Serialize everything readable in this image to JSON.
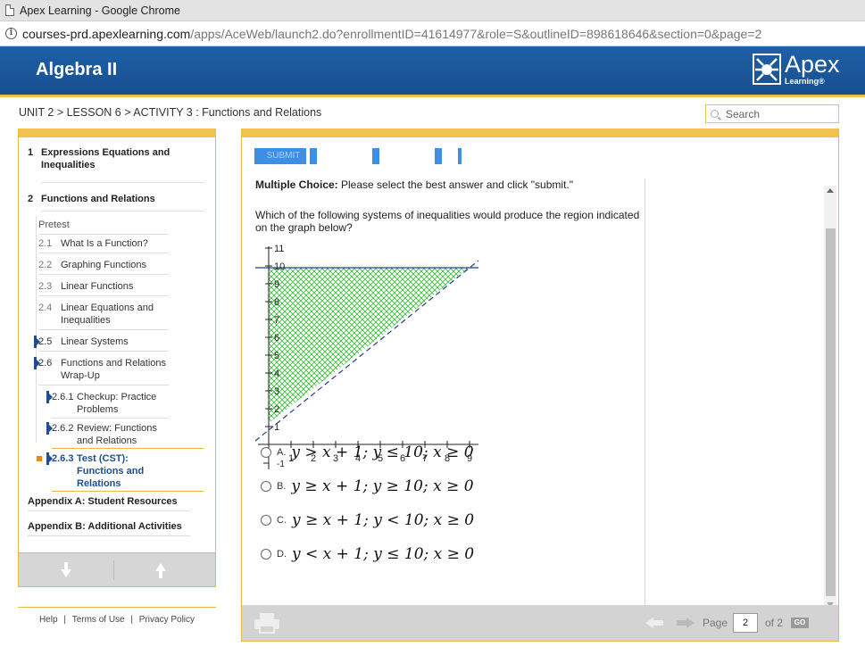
{
  "window": {
    "title": "Apex Learning - Google Chrome",
    "url_host": "courses-prd.apexlearning.com",
    "url_path": "/apps/AceWeb/launch2.do?enrollmentID=41614977&role=S&outlineID=898618646&section=0&page=2"
  },
  "header": {
    "course_title": "Algebra II",
    "logo_name": "Apex",
    "logo_sub": "Learning®"
  },
  "breadcrumb": "UNIT 2 > LESSON 6 > ACTIVITY 3 : Functions and Relations",
  "search": {
    "placeholder": "Search"
  },
  "nav": {
    "items": [
      {
        "num": "1",
        "label": "Expressions Equations and",
        "label2": "Inequalities"
      },
      {
        "num": "2",
        "label": "Functions and Relations"
      },
      {
        "num": "",
        "label": "Pretest"
      },
      {
        "num": "2.1",
        "label": "What Is a Function?"
      },
      {
        "num": "2.2",
        "label": "Graphing Functions"
      },
      {
        "num": "2.3",
        "label": "Linear Functions"
      },
      {
        "num": "2.4",
        "label": "Linear Equations and",
        "label2": "Inequalities"
      },
      {
        "num": "2.5",
        "label": "Linear Systems"
      },
      {
        "num": "2.6",
        "label": "Functions and Relations",
        "label2": "Wrap-Up"
      },
      {
        "num": "2.6.1",
        "label": "Checkup: Practice",
        "label2": "Problems"
      },
      {
        "num": "2.6.2",
        "label": "Review: Functions",
        "label2": "and Relations"
      },
      {
        "num": "2.6.3",
        "label": "Test (CST):",
        "label2": "Functions and",
        "label3": "Relations"
      },
      {
        "num": "",
        "label": "Appendix A: Student Resources"
      },
      {
        "num": "",
        "label": "Appendix B: Additional Activities"
      }
    ]
  },
  "footer_links": {
    "help": "Help",
    "terms": "Terms of Use",
    "privacy": "Privacy Policy",
    "sep": "|"
  },
  "question": {
    "submit_label": "SUBMIT",
    "type_label": "Multiple Choice:",
    "instructions": "Please select the best answer and click \"submit.\"",
    "prompt": "Which of the following systems of inequalities would produce the region indicated on the graph below?",
    "graph": {
      "x_ticks": [
        "1",
        "2",
        "3",
        "4",
        "5",
        "6",
        "7",
        "8",
        "9"
      ],
      "x_neg_label": "-1",
      "y_ticks": [
        "1",
        "2",
        "3",
        "4",
        "5",
        "6",
        "7",
        "8",
        "9",
        "10",
        "11"
      ],
      "shade_color": "#2fbf2f"
    },
    "choices": [
      {
        "letter": "A.",
        "math": "y > x + 1; y ≤ 10; x ≥ 0"
      },
      {
        "letter": "B.",
        "math": "y ≥ x + 1; y ≥ 10; x ≥ 0"
      },
      {
        "letter": "C.",
        "math": "y ≥ x + 1; y < 10; x ≥ 0"
      },
      {
        "letter": "D.",
        "math": "y < x + 1; y ≤ 10; x ≥ 0"
      }
    ]
  },
  "pager": {
    "page_label": "Page",
    "current": "2",
    "of_label": "of 2",
    "go_label": "GO"
  },
  "colors": {
    "header_blue": "#1f60a8",
    "gold": "#f2c14e",
    "submit_blue": "#3d8fe6"
  }
}
